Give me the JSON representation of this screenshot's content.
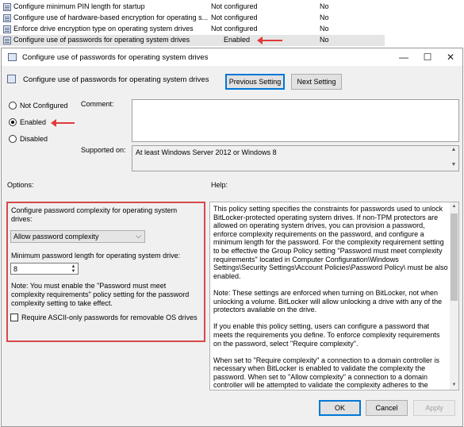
{
  "policy_list": [
    {
      "name": "Configure minimum PIN length for startup",
      "state": "Not configured",
      "comment": "No",
      "selected": false
    },
    {
      "name": "Configure use of hardware-based encryption for operating s...",
      "state": "Not configured",
      "comment": "No",
      "selected": false
    },
    {
      "name": "Enforce drive encryption type on operating system drives",
      "state": "Not configured",
      "comment": "No",
      "selected": false
    },
    {
      "name": "Configure use of passwords for operating system drives",
      "state": "Enabled",
      "comment": "No",
      "selected": true
    }
  ],
  "dialog": {
    "title": "Configure use of passwords for operating system drives",
    "window_controls": {
      "minimize": "—",
      "maximize": "☐",
      "close": "✕"
    },
    "header": "Configure use of passwords for operating system drives",
    "prev_button": "Previous Setting",
    "next_button": "Next Setting",
    "radios": {
      "not_configured": "Not Configured",
      "enabled": "Enabled",
      "disabled": "Disabled",
      "selected": "enabled"
    },
    "comment_label": "Comment:",
    "comment_value": "",
    "supported_on_label": "Supported on:",
    "supported_on_value": "At least Windows Server 2012 or Windows 8",
    "options_label": "Options:",
    "help_label": "Help:",
    "options": {
      "complexity_label": "Configure password complexity for operating system drives:",
      "complexity_value": "Allow password complexity",
      "min_length_label": "Minimum password length for operating system drive:",
      "min_length_value": "8",
      "note": "Note: You must enable the \"Password must meet complexity requirements\" policy setting for the password complexity setting to take effect.",
      "ascii_label": "Require ASCII-only passwords for removable OS drives",
      "ascii_checked": false
    },
    "help": [
      "This policy setting specifies the constraints for passwords used to unlock BitLocker-protected operating system drives. If non-TPM protectors are allowed on operating system drives, you can provision a password, enforce complexity requirements on the password, and configure a minimum length for the password. For the complexity requirement setting to be effective the Group Policy setting \"Password must meet complexity requirements\" located in Computer Configuration\\Windows Settings\\Security Settings\\Account Policies\\Password Policy\\ must be also enabled.",
      "Note: These settings are enforced when turning on BitLocker, not when unlocking a volume. BitLocker will allow unlocking a drive with any of the protectors available on the drive.",
      "If you enable this policy setting, users can configure a password that meets the requirements you define. To enforce complexity requirements on the password, select \"Require complexity\".",
      "When set to \"Require complexity\" a connection to a domain controller is necessary when BitLocker is enabled to validate the complexity the password. When set to \"Allow complexity\" a connection to a domain controller will be attempted to validate the complexity adheres to the"
    ],
    "ok_button": "OK",
    "cancel_button": "Cancel",
    "apply_button": "Apply"
  },
  "colors": {
    "annotation_red": "#e03a3a",
    "focus_blue": "#0078d7"
  }
}
